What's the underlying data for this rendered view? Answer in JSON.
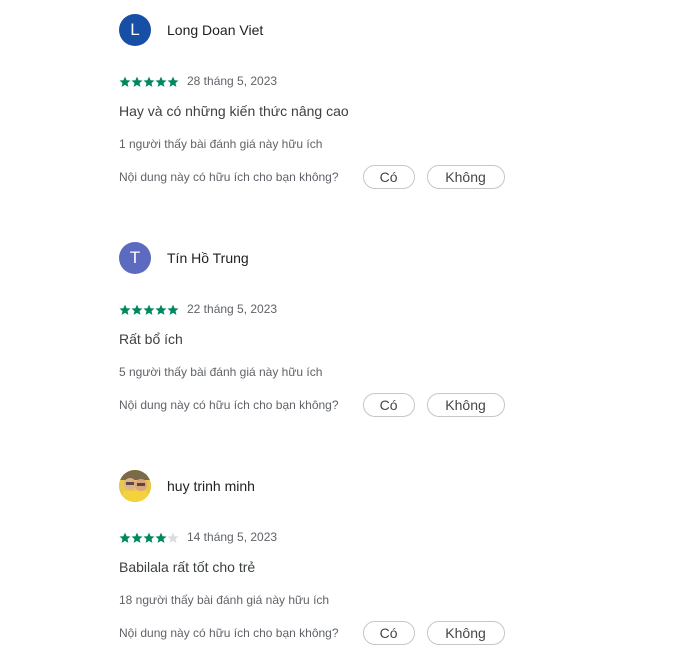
{
  "feedback_question": "Nội dung này có hữu ích cho bạn không?",
  "yes_label": "Có",
  "no_label": "Không",
  "colors": {
    "star_filled": "#01875f",
    "star_empty": "#dadce0"
  },
  "reviews": [
    {
      "author": "Long Doan Viet",
      "avatar_letter": "L",
      "avatar_color": "#174ea6",
      "rating": 5,
      "date": "28 tháng 5, 2023",
      "text": "Hay và có những kiến thức nâng cao",
      "helpful": "1 người thấy bài đánh giá này hữu ích"
    },
    {
      "author": "Tín Hồ Trung",
      "avatar_letter": "T",
      "avatar_color": "#5c6bc0",
      "rating": 5,
      "date": "22 tháng 5, 2023",
      "text": "Rất bổ ích",
      "helpful": "5 người thấy bài đánh giá này hữu ích"
    },
    {
      "author": "huy trinh minh",
      "avatar_letter": "",
      "avatar_color": "#f1c40f",
      "rating": 4,
      "date": "14 tháng 5, 2023",
      "text": "Babilala rất tốt cho trẻ",
      "helpful": "18 người thấy bài đánh giá này hữu ích"
    }
  ]
}
